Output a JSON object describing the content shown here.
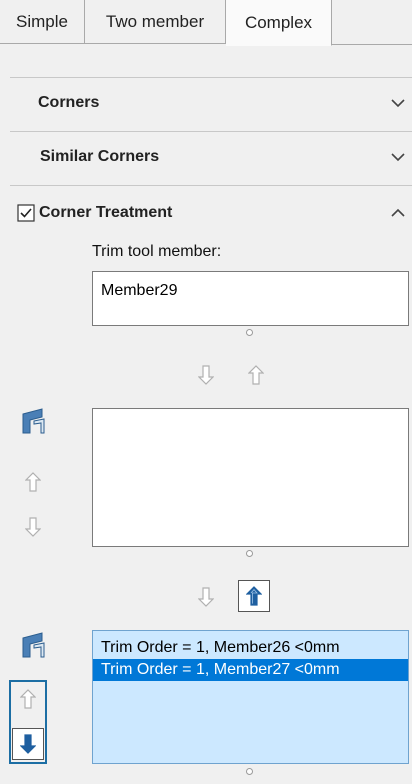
{
  "tabs": [
    {
      "label": "Simple"
    },
    {
      "label": "Two member"
    },
    {
      "label": "Complex"
    }
  ],
  "sections": {
    "corners": {
      "label": "Corners"
    },
    "similar_corners": {
      "label": "Similar Corners"
    },
    "corner_treatment": {
      "label": "Corner Treatment",
      "checked": true
    }
  },
  "trim_tool": {
    "label": "Trim tool member:",
    "value": "Member29"
  },
  "trim_list": {
    "rows": [
      {
        "text": "Trim Order = 1, Member26  <0mm",
        "selected": false
      },
      {
        "text": "Trim Order = 1, Member27  <0mm",
        "selected": true
      }
    ]
  },
  "colors": {
    "selection": "#0078d7",
    "list_bg": "#cce8ff",
    "focus_frame": "#1c6ea4",
    "active_arrow": "#1e5fa0"
  },
  "icons": [
    "chevron-down-icon",
    "chevron-up-icon",
    "checkbox-icon",
    "arrow-down-icon",
    "arrow-up-icon",
    "trim-member-icon"
  ]
}
